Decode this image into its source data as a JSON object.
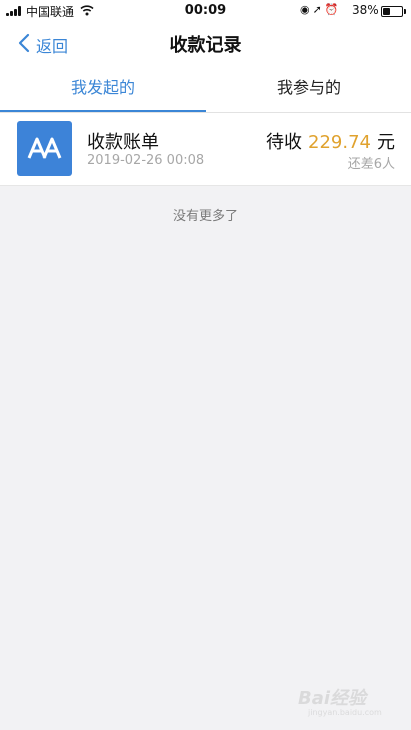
{
  "status_bar": {
    "carrier": "中国联通",
    "time": "00:09",
    "battery": "38%",
    "battery_level": 0.38
  },
  "nav": {
    "back_label": "返回",
    "title": "收款记录"
  },
  "tabs": [
    {
      "label": "我发起的",
      "active": true
    },
    {
      "label": "我参与的",
      "active": false
    }
  ],
  "records": [
    {
      "title": "收款账单",
      "date": "2019-02-26 00:08",
      "status_prefix": "待收",
      "amount": "229.74",
      "currency": "元",
      "remaining": "还差6人",
      "icon": "aa-icon"
    }
  ],
  "footer_text": "没有更多了",
  "watermark": {
    "text": "Bai经验",
    "sub": "jingyan.baidu.com"
  },
  "colors": {
    "accent": "#3b86d6",
    "amount": "#e0a22e",
    "avatar_bg": "#3d83d8"
  }
}
